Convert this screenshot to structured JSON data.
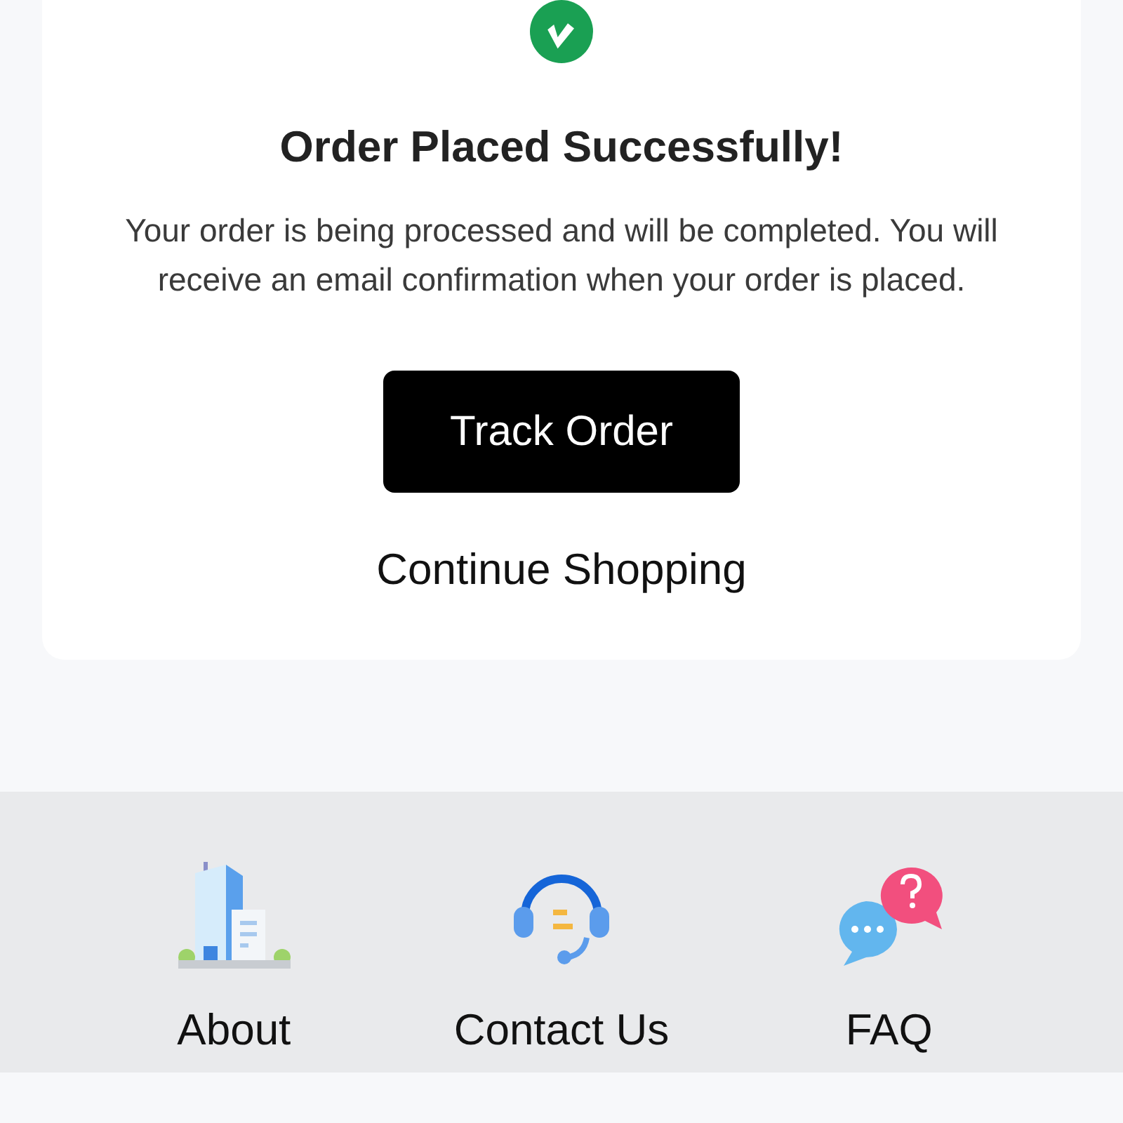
{
  "confirmation": {
    "title": "Order Placed Successfully!",
    "message": "Your order is being processed and will be completed. You will receive an email confirmation when your order is placed.",
    "primary_button": "Track Order",
    "secondary_link": "Continue Shopping"
  },
  "footer_links": [
    {
      "kind": "building",
      "label": "About"
    },
    {
      "kind": "headset",
      "label": "Contact Us"
    },
    {
      "kind": "chat",
      "label": "FAQ"
    }
  ]
}
